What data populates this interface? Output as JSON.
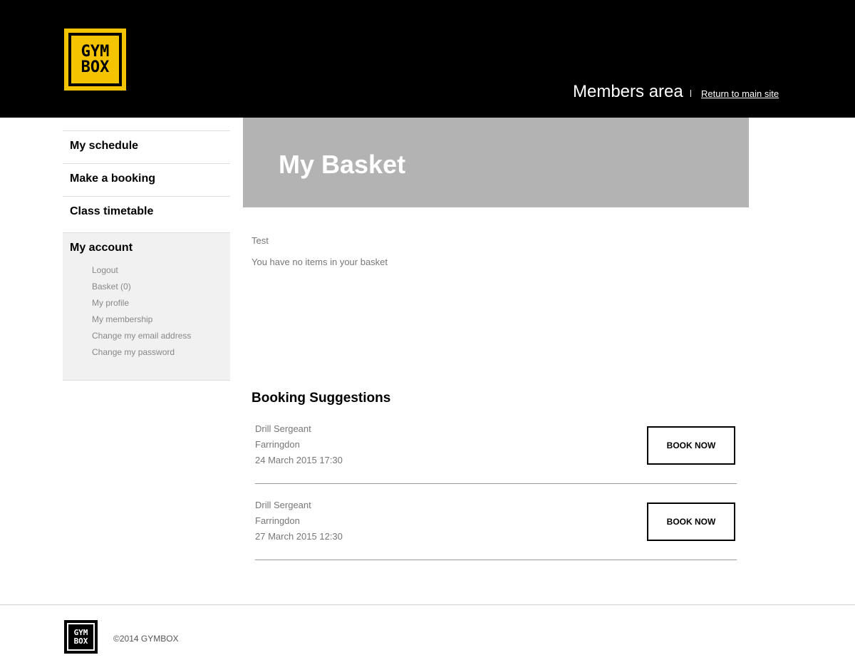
{
  "header": {
    "logo": {
      "line1": "GYM",
      "line2": "BOX",
      "tm": "™"
    },
    "members_area": "Members area",
    "return_link": "Return to main site"
  },
  "sidebar": {
    "items": [
      {
        "label": "My schedule"
      },
      {
        "label": "Make a booking"
      },
      {
        "label": "Class timetable"
      }
    ],
    "account": {
      "title": "My account",
      "links": [
        {
          "label": "Logout"
        },
        {
          "label": "Basket (0)"
        },
        {
          "label": "My profile"
        },
        {
          "label": "My membership"
        },
        {
          "label": "Change my email address"
        },
        {
          "label": "Change my password"
        }
      ]
    }
  },
  "main": {
    "title": "My Basket",
    "test_text": "Test",
    "empty_text": "You have no items in your basket",
    "suggestions_title": "Booking Suggestions",
    "suggestions": [
      {
        "class_name": "Drill Sergeant",
        "location": "Farringdon",
        "datetime": "24 March 2015 17:30",
        "button": "BOOK NOW"
      },
      {
        "class_name": "Drill Sergeant",
        "location": "Farringdon",
        "datetime": "27 March 2015 12:30",
        "button": "BOOK NOW"
      }
    ]
  },
  "footer": {
    "logo": {
      "line1": "GYM",
      "line2": "BOX"
    },
    "copyright": "©2014 GYMBOX"
  },
  "colors": {
    "header_bg": "#000000",
    "logo_yellow": "#f5c400",
    "banner_bg": "#b3b3b3",
    "account_bg": "#f1f1f1"
  }
}
